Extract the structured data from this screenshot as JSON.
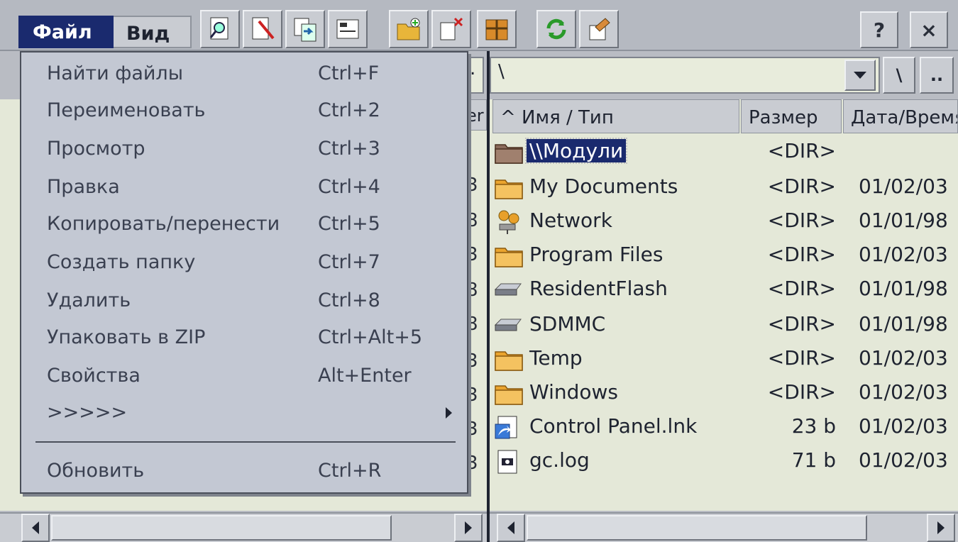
{
  "menubar": {
    "file": "Файл",
    "view": "Вид"
  },
  "toolbar": {
    "icons": [
      "find-icon",
      "rename-icon",
      "copy-icon",
      "view-icon",
      "new-folder-icon",
      "delete-icon",
      "zip-icon",
      "refresh-icon",
      "properties-icon"
    ],
    "help": "?",
    "close": "×"
  },
  "path": {
    "value": "\\",
    "left_dot": ".",
    "root_btn": "\\",
    "up_btn": ".."
  },
  "file_menu": {
    "items": [
      {
        "label": "Найти файлы",
        "shortcut": "Ctrl+F"
      },
      {
        "label": "Переименовать",
        "shortcut": "Ctrl+2"
      },
      {
        "label": "Просмотр",
        "shortcut": "Ctrl+3"
      },
      {
        "label": "Правка",
        "shortcut": "Ctrl+4"
      },
      {
        "label": "Копировать/перенести",
        "shortcut": "Ctrl+5"
      },
      {
        "label": "Создать папку",
        "shortcut": "Ctrl+7"
      },
      {
        "label": "Удалить",
        "shortcut": "Ctrl+8"
      },
      {
        "label": "Упаковать в ZIP",
        "shortcut": "Ctrl+Alt+5"
      },
      {
        "label": "Свойства",
        "shortcut": "Alt+Enter"
      },
      {
        "label": ">>>>>",
        "shortcut": ""
      }
    ],
    "refresh": {
      "label": "Обновить",
      "shortcut": "Ctrl+R"
    }
  },
  "left_pane": {
    "header_fragment": "er",
    "digits": [
      "3",
      "8",
      "3",
      "8",
      "8",
      "3",
      "3",
      "3",
      "3"
    ]
  },
  "right_pane": {
    "columns": {
      "name": "^ Имя / Тип",
      "size": "Размер",
      "date": "Дата/Время"
    },
    "files": [
      {
        "name": "\\\\Модули",
        "size": "<DIR>",
        "date": "",
        "icon": "network-folder-icon",
        "selected": true
      },
      {
        "name": "My Documents",
        "size": "<DIR>",
        "date": "01/02/03",
        "icon": "folder-icon"
      },
      {
        "name": "Network",
        "size": "<DIR>",
        "date": "01/01/98",
        "icon": "network-icon"
      },
      {
        "name": "Program Files",
        "size": "<DIR>",
        "date": "01/02/03",
        "icon": "folder-icon"
      },
      {
        "name": "ResidentFlash",
        "size": "<DIR>",
        "date": "01/01/98",
        "icon": "drive-icon"
      },
      {
        "name": "SDMMC",
        "size": "<DIR>",
        "date": "01/01/98",
        "icon": "drive-icon"
      },
      {
        "name": "Temp",
        "size": "<DIR>",
        "date": "01/02/03",
        "icon": "folder-icon"
      },
      {
        "name": "Windows",
        "size": "<DIR>",
        "date": "01/02/03",
        "icon": "folder-icon"
      },
      {
        "name": "Control Panel.lnk",
        "size": "23 b",
        "date": "01/02/03",
        "icon": "shortcut-icon"
      },
      {
        "name": "gc.log",
        "size": "71 b",
        "date": "01/02/03",
        "icon": "log-file-icon"
      }
    ]
  },
  "colors": {
    "menu_active": "#1a2a6e",
    "pane_bg": "#e4e8d8",
    "folder": "#e8a02a"
  }
}
